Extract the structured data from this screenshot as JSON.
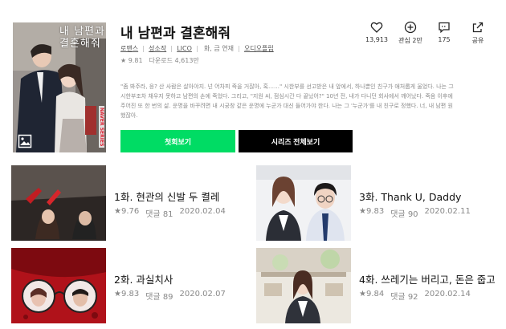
{
  "series": {
    "title": "내 남편과 결혼해줘",
    "cover_title": "내 남편과 결혼해줘",
    "cover_badge": "NAVER SERIES",
    "genre": "로맨스",
    "author1": "성소작",
    "author2": "LICO",
    "schedule": "화, 금 연재",
    "publisher": "오디오플립",
    "rating": "9.81",
    "downloads": "다운로드 4,613만",
    "synopsis": "\"좀 봐주라, 응? 산 사람은 살아야지. 넌 어차피 죽을 거잖아, 혹……\" 시한부를 선고받은 내 앞에서, 하나뿐인 친구가 애처롭게 울었다. 나는 그 시한부조차 채우지 못하고 남편의 손에 죽었다. 그리고, \"지원 씨, 점심시간 다 끝났어?\" 10년 전, 내가 다니던 회사에서 깨어났다. 죽음 이후에 주어진 또 한 번의 삶. 운명을 바꾸려면 내 시궁창 같은 운명에 누군가 대신 들어가야 한다. 나는 그 '누군가'를 내 친구로 정했다. 너, 내 남편 원했잖아."
  },
  "actions": [
    {
      "icon": "heart-icon",
      "label": "13,913"
    },
    {
      "icon": "plus-circle-icon",
      "label": "관심 2만"
    },
    {
      "icon": "comment-icon",
      "label": "175"
    },
    {
      "icon": "share-icon",
      "label": "공유"
    }
  ],
  "buttons": {
    "first": "첫회보기",
    "all": "시리즈 전체보기"
  },
  "episodes": [
    {
      "title": "1화. 현관의 신발 두 켤레",
      "rating": "★9.76",
      "comments": "댓글 81",
      "date": "2020.02.04"
    },
    {
      "title": "2화. 과실치사",
      "rating": "★9.83",
      "comments": "댓글 89",
      "date": "2020.02.07"
    },
    {
      "title": "3화. Thank U, Daddy",
      "rating": "★9.83",
      "comments": "댓글 90",
      "date": "2020.02.11"
    },
    {
      "title": "4화. 쓰레기는 버리고, 돈은 줍고",
      "rating": "★9.84",
      "comments": "댓글 92",
      "date": "2020.02.14"
    }
  ],
  "colors": {
    "accent_green": "#00dc64",
    "button_black": "#000000"
  }
}
